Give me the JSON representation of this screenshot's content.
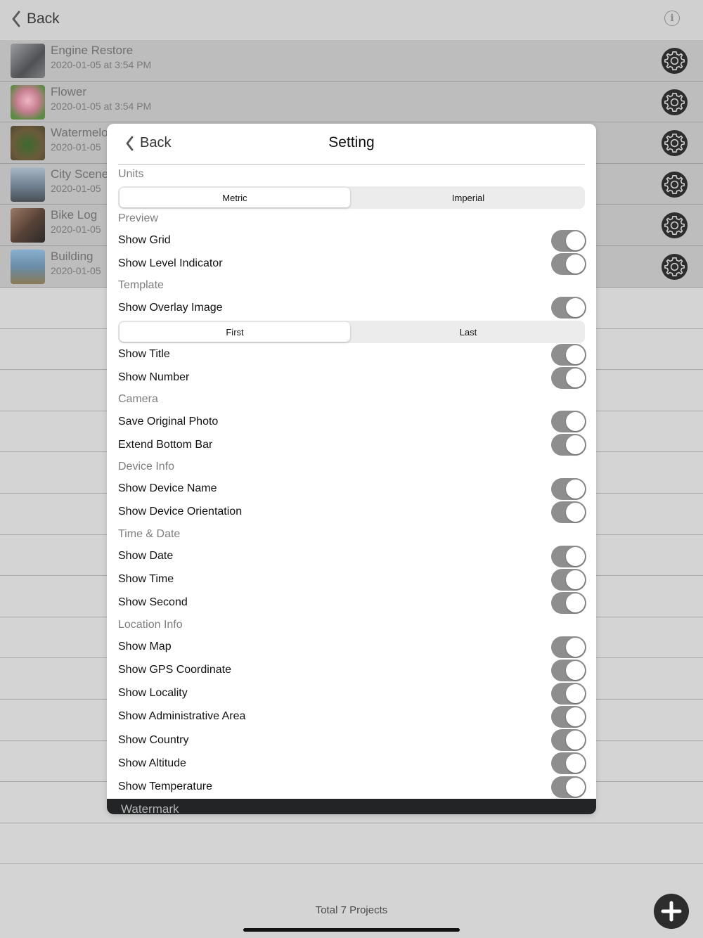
{
  "nav": {
    "back_label": "Back"
  },
  "projects": [
    {
      "name": "Engine Restore",
      "date": "2020-01-05 at 3:54 PM",
      "thumb_color": "#6a6c6e"
    },
    {
      "name": "Flower",
      "date": "2020-01-05 at 3:54 PM",
      "thumb_color": "#c37d8e"
    },
    {
      "name": "Watermelo",
      "date": "2020-01-05",
      "thumb_color": "#5b6b3d"
    },
    {
      "name": "City Scene",
      "date": "2020-01-05",
      "thumb_color": "#7a8c9e"
    },
    {
      "name": "Bike Log",
      "date": "2020-01-05",
      "thumb_color": "#6e5446"
    },
    {
      "name": "Building",
      "date": "2020-01-05",
      "thumb_color": "#6d8ea8"
    }
  ],
  "footer": {
    "total": "Total 7 Projects"
  },
  "modal": {
    "title": "Setting",
    "back_label": "Back",
    "units_section": "Units",
    "units_options": [
      "Metric",
      "Imperial"
    ],
    "units_selected": "Metric",
    "preview_section": "Preview",
    "show_grid": "Show Grid",
    "show_level": "Show Level Indicator",
    "template_section": "Template",
    "show_overlay": "Show Overlay Image",
    "overlay_options": [
      "First",
      "Last"
    ],
    "overlay_selected": "First",
    "show_title": "Show Title",
    "show_number": "Show Number",
    "camera_section": "Camera",
    "save_original": "Save Original Photo",
    "extend_bottom": "Extend Bottom Bar",
    "device_section": "Device Info",
    "show_device_name": "Show Device Name",
    "show_device_orientation": "Show Device Orientation",
    "time_section": "Time & Date",
    "show_date": "Show Date",
    "show_time": "Show Time",
    "show_second": "Show Second",
    "location_section": "Location Info",
    "show_map": "Show Map",
    "show_gps": "Show GPS Coordinate",
    "show_locality": "Show Locality",
    "show_admin_area": "Show Administrative Area",
    "show_country": "Show Country",
    "show_altitude": "Show Altitude",
    "show_temperature": "Show Temperature",
    "watermark_label": "Watermark"
  }
}
